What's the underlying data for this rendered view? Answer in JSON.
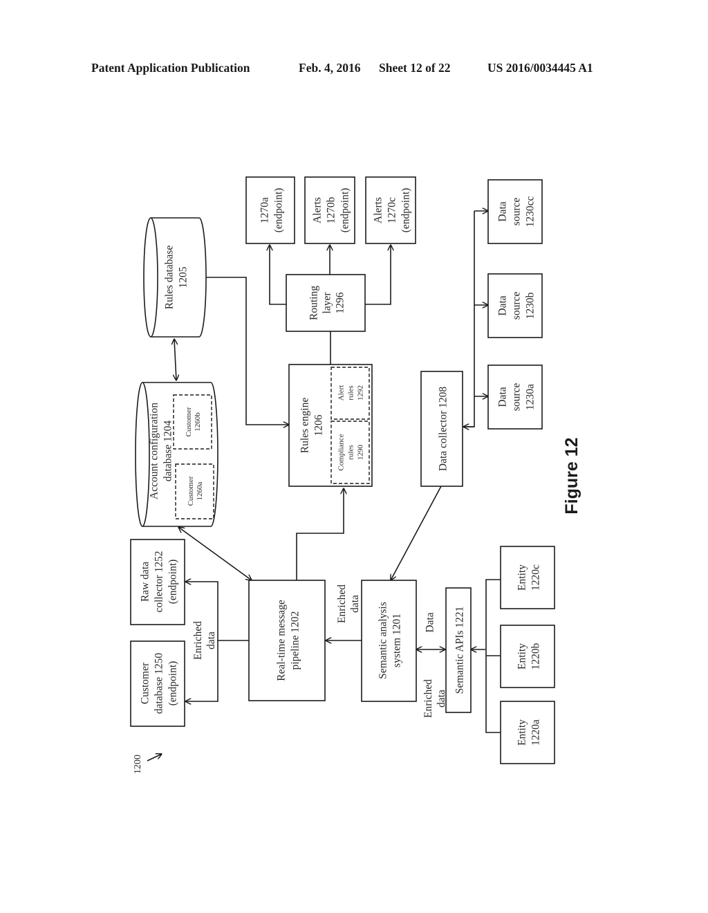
{
  "header": {
    "publication": "Patent Application Publication",
    "date": "Feb. 4, 2016",
    "sheet": "Sheet 12 of 22",
    "number": "US 2016/0034445 A1"
  },
  "figure": {
    "label": "Figure 12",
    "ref": "1200"
  },
  "nodes": {
    "rules_db": [
      "Rules database",
      "1205"
    ],
    "account_db": [
      "Account configuration",
      "database 1204"
    ],
    "customer_a": [
      "Customer",
      "1260a"
    ],
    "customer_b": [
      "Customer",
      "1260b"
    ],
    "raw_collector": [
      "Raw data",
      "collector 1252",
      "(endpoint)"
    ],
    "customer_db": [
      "Customer",
      "database 1250",
      "(endpoint)"
    ],
    "pipeline": [
      "Real-time message",
      "pipeline 1202"
    ],
    "rules_engine": [
      "Rules engine",
      "1206"
    ],
    "compliance_rules": [
      "Compliance",
      "rules",
      "1290"
    ],
    "alert_rules": [
      "Alert",
      "rules",
      "1292"
    ],
    "routing": [
      "Routing",
      "layer",
      "1296"
    ],
    "endpoint_a": [
      "1270a",
      "(endpoint)"
    ],
    "endpoint_b": [
      "Alerts",
      "1270b",
      "(endpoint)"
    ],
    "endpoint_c": [
      "Alerts",
      "1270c",
      "(endpoint)"
    ],
    "data_collector": [
      "Data collector 1208"
    ],
    "source_a": [
      "Data",
      "source",
      "1230a"
    ],
    "source_b": [
      "Data",
      "source",
      "1230b"
    ],
    "source_cc": [
      "Data",
      "source",
      "1230cc"
    ],
    "semantic_system": [
      "Semantic analysis",
      "system 1201"
    ],
    "semantic_apis": [
      "Semantic APIs 1221"
    ],
    "entity_a": [
      "Entity",
      "1220a"
    ],
    "entity_b": [
      "Entity",
      "1220b"
    ],
    "entity_c": [
      "Entity",
      "1220c"
    ]
  },
  "edge_labels": {
    "enriched_out": [
      "Enriched",
      "data"
    ],
    "enriched_in": [
      "Enriched",
      "data"
    ],
    "data": [
      "Data"
    ],
    "enriched_back": [
      "Enriched",
      "data"
    ]
  }
}
